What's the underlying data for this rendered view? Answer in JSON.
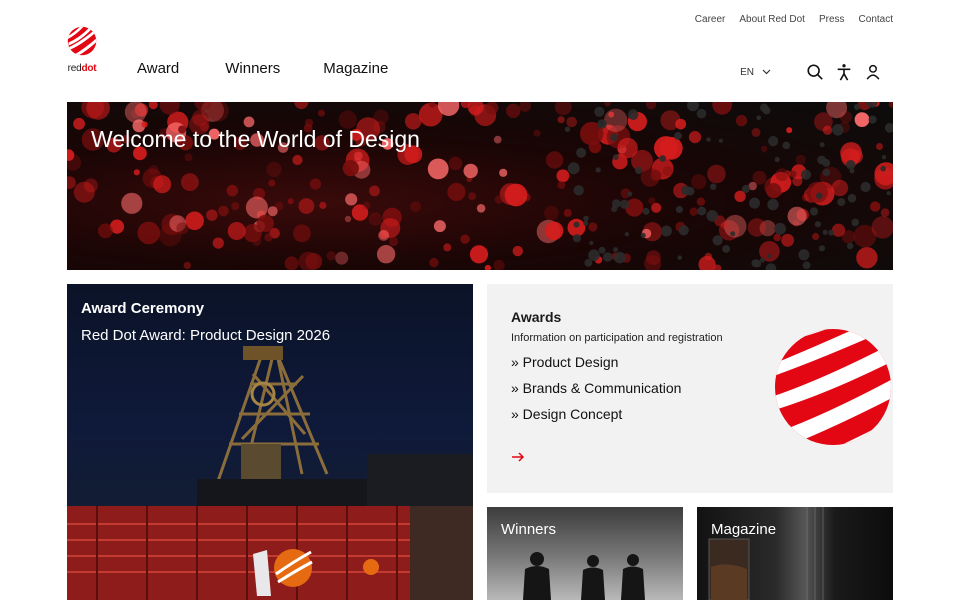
{
  "utility_nav": [
    "Career",
    "About Red Dot",
    "Press",
    "Contact"
  ],
  "logo": {
    "word_red": "red",
    "word_dot": "dot"
  },
  "main_nav": [
    "Award",
    "Winners",
    "Magazine"
  ],
  "language": {
    "current": "EN"
  },
  "tool_icons": [
    "search-icon",
    "accessibility-icon",
    "user-icon"
  ],
  "hero": {
    "title": "Welcome to the World of Design"
  },
  "ceremony": {
    "kicker": "Award Ceremony",
    "subtitle": "Red Dot Award: Product Design 2026"
  },
  "awards": {
    "title": "Awards",
    "info": "Information on participation and registration",
    "links": [
      "» Product Design",
      "» Brands & Communication",
      "» Design Concept"
    ]
  },
  "tiles": {
    "winners": "Winners",
    "magazine": "Magazine"
  },
  "colors": {
    "brand_red": "#e30613",
    "panel_grey": "#f2f2f2"
  }
}
